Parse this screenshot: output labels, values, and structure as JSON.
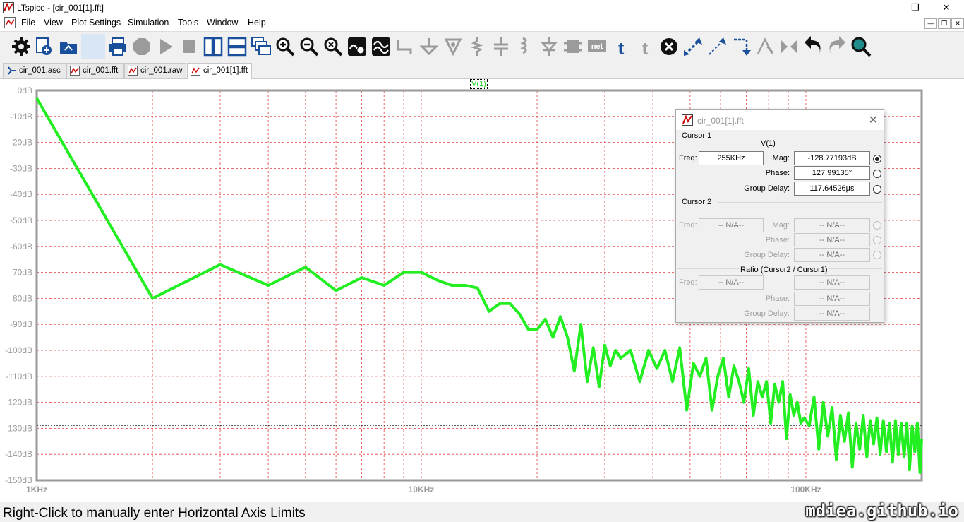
{
  "window": {
    "title": "LTspice - [cir_001[1].fft]",
    "minimize": "—",
    "maximize": "❐",
    "close": "✕"
  },
  "menu": {
    "items": [
      "File",
      "View",
      "Plot Settings",
      "Simulation",
      "Tools",
      "Window",
      "Help"
    ],
    "mdi": [
      "—",
      "❐",
      "✕"
    ]
  },
  "toolbar": {
    "icons": [
      "settings-icon",
      "new-schematic-icon",
      "open-icon",
      "blank-icon",
      "print-icon",
      "halt-icon",
      "run-icon",
      "stop-icon",
      "tile-vertical-icon",
      "tile-horizontal-icon",
      "cascade-icon",
      "zoom-in-icon",
      "zoom-out-icon",
      "zoom-fit-icon",
      "autorange-icon",
      "pick-trace-icon",
      "wire-icon",
      "ground-icon",
      "label-icon",
      "resistor-icon",
      "capacitor-icon",
      "inductor-icon",
      "diode-icon",
      "component-icon",
      "netlabel-icon",
      "text-icon",
      "spice-directive-icon",
      "delete-icon",
      "move-icon",
      "drag-icon",
      "rotate-icon",
      "mirror-icon",
      "flip-icon",
      "undo-icon",
      "redo-icon",
      "find-icon"
    ]
  },
  "tabs": [
    {
      "label": "cir_001.asc",
      "icon": "schematic-icon",
      "active": false
    },
    {
      "label": "cir_001.fft",
      "icon": "waveform-icon",
      "active": false
    },
    {
      "label": "cir_001.raw",
      "icon": "waveform-icon",
      "active": false
    },
    {
      "label": "cir_001[1].fft",
      "icon": "waveform-icon",
      "active": true
    }
  ],
  "chart_data": {
    "type": "line",
    "title": "",
    "trace_label": "V(1)",
    "x_scale": "log",
    "xlim": [
      1000,
      200000
    ],
    "x_tick_labels": [
      "1KHz",
      "10KHz",
      "100KHz"
    ],
    "ylim": [
      -150,
      0
    ],
    "y_tick_labels": [
      "0dB",
      "-10dB",
      "-20dB",
      "-30dB",
      "-40dB",
      "-50dB",
      "-60dB",
      "-70dB",
      "-80dB",
      "-90dB",
      "-100dB",
      "-110dB",
      "-120dB",
      "-130dB",
      "-140dB",
      "-150dB"
    ],
    "grid": true,
    "cursor_level_db": -128.77,
    "series": [
      {
        "name": "V(1)",
        "color": "#22ee22",
        "x": [
          1000,
          2000,
          3000,
          4000,
          5000,
          6000,
          7000,
          8000,
          9000,
          10000,
          11000,
          12000,
          13000,
          14000,
          15000,
          16000,
          17000,
          18000,
          19000,
          20000,
          21000,
          22000,
          23000,
          24000,
          25000,
          26000,
          27000,
          28000,
          29000,
          30000,
          31000,
          32000,
          33000,
          35000,
          37000,
          39000,
          41000,
          43000,
          45000,
          47000,
          49000,
          51000,
          53000,
          55000,
          57000,
          59000,
          61000,
          63000,
          65000,
          67000,
          69000,
          71000,
          73000,
          75000,
          77000,
          79000,
          81000,
          83000,
          85000,
          87000,
          89000,
          91000,
          93000,
          95000,
          97000,
          99000,
          102000,
          105000,
          108000,
          111000,
          114000,
          117000,
          120000,
          123000,
          126000,
          129000,
          132000,
          135000,
          138000,
          141000,
          144000,
          147000,
          150000,
          153000,
          156000,
          159000,
          162000,
          165000,
          168000,
          171000,
          174000,
          177000,
          180000,
          183000,
          186000,
          189000,
          192000,
          195000,
          198000,
          200000
        ],
        "y": [
          -3,
          -80,
          -67,
          -75,
          -68,
          -77,
          -72,
          -75,
          -70,
          -70,
          -73,
          -75,
          -75,
          -76,
          -85,
          -82,
          -82,
          -86,
          -92,
          -92,
          -88,
          -95,
          -87,
          -95,
          -108,
          -90,
          -112,
          -99,
          -114,
          -98,
          -106,
          -100,
          -103,
          -100,
          -112,
          -100,
          -107,
          -100,
          -112,
          -99,
          -123,
          -105,
          -110,
          -103,
          -123,
          -110,
          -103,
          -118,
          -106,
          -112,
          -120,
          -107,
          -125,
          -112,
          -118,
          -112,
          -128,
          -113,
          -120,
          -112,
          -134,
          -117,
          -125,
          -120,
          -128,
          -126,
          -129,
          -118,
          -138,
          -120,
          -133,
          -122,
          -142,
          -125,
          -135,
          -124,
          -145,
          -128,
          -138,
          -125,
          -141,
          -127,
          -136,
          -126,
          -140,
          -127,
          -139,
          -128,
          -143,
          -127,
          -140,
          -128,
          -141,
          -128,
          -146,
          -129,
          -139,
          -128,
          -147,
          -134
        ]
      }
    ]
  },
  "cursor_dialog": {
    "title": "cir_001[1].fft",
    "close": "✕",
    "cursor1": {
      "label": "Cursor 1",
      "trace": "V(1)",
      "freq_label": "Freq:",
      "freq": "255KHz",
      "mag_label": "Mag:",
      "mag": "-128.77193dB",
      "phase_label": "Phase:",
      "phase": "127.99135°",
      "gd_label": "Group Delay:",
      "gd": "117.64526µs"
    },
    "cursor2": {
      "label": "Cursor 2",
      "freq_label": "Freq:",
      "freq": "-- N/A--",
      "mag_label": "Mag:",
      "mag": "-- N/A--",
      "phase_label": "Phase:",
      "phase": "-- N/A--",
      "gd_label": "Group Delay:",
      "gd": "-- N/A--"
    },
    "ratio": {
      "label": "Ratio (Cursor2 / Cursor1)",
      "freq_label": "Freq:",
      "freq": "-- N/A--",
      "phase_label": "Phase:",
      "phase": "-- N/A--",
      "mag_label": "Mag:",
      "mag": "-- N/A--",
      "gd_label": "Group Delay:",
      "gd": "-- N/A--"
    }
  },
  "status": {
    "text": "Right-Click to manually enter Horizontal Axis Limits"
  },
  "watermark": "mdiea.github.io"
}
